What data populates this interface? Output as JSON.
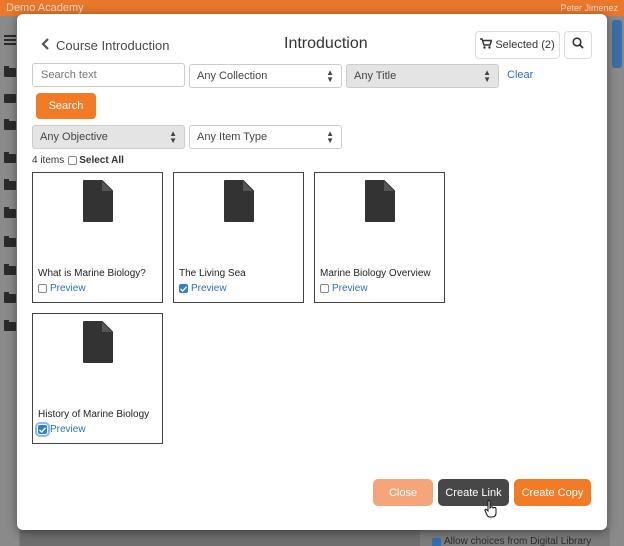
{
  "app": {
    "name": "Demo Academy",
    "user": "Peter Jimenez"
  },
  "background": {
    "checkbox_text": "Allow choices from Digital Library"
  },
  "modal": {
    "back_label": "Course Introduction",
    "title": "Introduction",
    "selected_label": "Selected (2)",
    "search_placeholder": "Search text",
    "filters": {
      "collection": "Any Collection",
      "title": "Any Title",
      "objective": "Any Objective",
      "item_type": "Any Item Type"
    },
    "clear_label": "Clear",
    "search_button": "Search",
    "item_count": "4 items",
    "select_all": "Select All",
    "items": [
      {
        "name": "What is Marine Biology?",
        "preview": "Preview",
        "checked": false
      },
      {
        "name": "The Living Sea",
        "preview": "Preview",
        "checked": true
      },
      {
        "name": "Marine Biology Overview",
        "preview": "Preview",
        "checked": false
      },
      {
        "name": "History of Marine Biology",
        "preview": "Preview",
        "checked": true
      }
    ],
    "buttons": {
      "close": "Close",
      "create_link": "Create Link",
      "create_copy": "Create Copy"
    }
  },
  "colors": {
    "accent": "#f47b26",
    "link": "#2a74b8",
    "dark_button": "#474747",
    "checkbox": "#2f7fd3"
  }
}
